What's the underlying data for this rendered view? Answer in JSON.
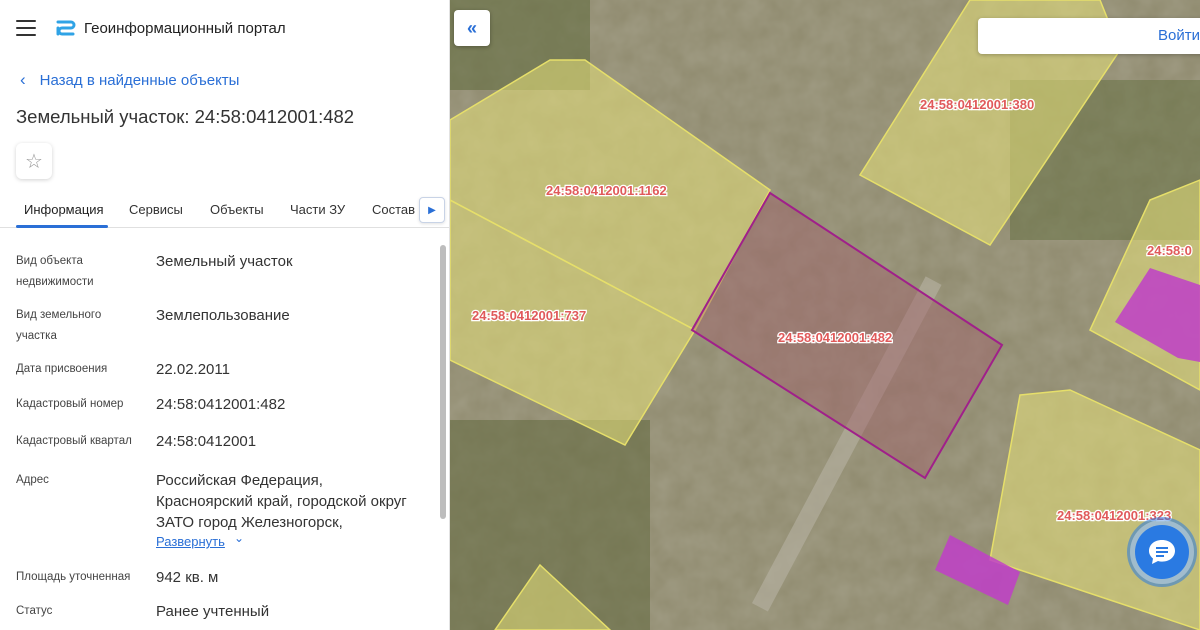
{
  "header": {
    "portal_title": "Геоинформационный портал"
  },
  "navigation": {
    "back_label": "Назад в найденные объекты"
  },
  "parcel": {
    "title": "Земельный участок: 24:58:0412001:482"
  },
  "tabs": [
    {
      "label": "Информация",
      "active": true
    },
    {
      "label": "Сервисы",
      "active": false
    },
    {
      "label": "Объекты",
      "active": false
    },
    {
      "label": "Части ЗУ",
      "active": false
    },
    {
      "label": "Состав",
      "active": false
    }
  ],
  "info": {
    "object_type": {
      "label_line1": "Вид объекта",
      "label_line2": "недвижимости",
      "value": "Земельный участок"
    },
    "land_type": {
      "label_line1": "Вид земельного",
      "label_line2": "участка",
      "value": "Землепользование"
    },
    "assign_date": {
      "label": "Дата присвоения",
      "value": "22.02.2011"
    },
    "cadastral_number": {
      "label": "Кадастровый номер",
      "value": "24:58:0412001:482"
    },
    "cadastral_quarter": {
      "label": "Кадастровый квартал",
      "value": "24:58:0412001"
    },
    "address": {
      "label": "Адрес",
      "line1": "Российская Федерация,",
      "line2": "Красноярский край, городской округ",
      "line3": "ЗАТО город Железногорск,",
      "expand_label": "Развернуть"
    },
    "area": {
      "label": "Площадь уточненная",
      "value": "942 кв. м"
    },
    "status": {
      "label": "Статус",
      "value": "Ранее учтенный"
    }
  },
  "map": {
    "login_label": "Войти",
    "parcel_labels": {
      "p1162": "24:58:0412001:1162",
      "p380": "24:58:0412001:380",
      "p737": "24:58:0412001:737",
      "p482": "24:58:0412001:482",
      "p323": "24:58:0412001:323",
      "p_partial": "24:58:0"
    }
  },
  "colors": {
    "accent": "#2a6fd6",
    "parcel_fill": "#e8e27a",
    "parcel_stroke": "#e6df6a",
    "selected_stroke": "#a0208a",
    "building_fill": "#c03ec8",
    "label_text": "#e05a5a"
  },
  "icons": {
    "menu": "hamburger-icon",
    "logo": "portal-logo-icon",
    "back": "chevron-left-icon",
    "favorite": "star-icon",
    "tabs_next": "chevron-right-icon",
    "collapse": "double-chevron-left-icon",
    "expand": "chevron-down-icon",
    "chat": "chat-bubble-icon"
  }
}
